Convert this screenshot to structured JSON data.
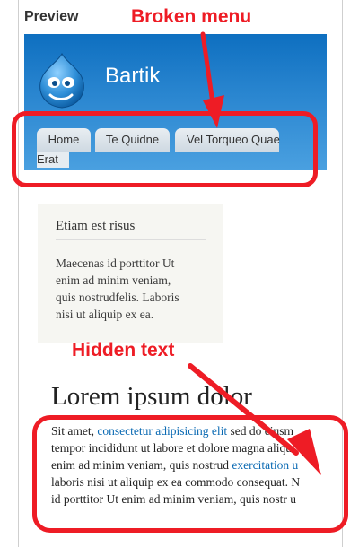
{
  "preview": {
    "label": "Preview"
  },
  "site": {
    "name": "Bartik"
  },
  "menu": {
    "items": [
      "Home",
      "Te Quidne",
      "Vel Torqueo Quae"
    ],
    "overflow": "Erat"
  },
  "block": {
    "title": "Etiam est risus",
    "body": [
      "Maecenas id porttitor Ut",
      "enim ad minim veniam,",
      "quis nostrudfelis. Laboris",
      "nisi ut aliquip ex ea."
    ]
  },
  "content": {
    "title": "Lorem ipsum dolor",
    "line1_a": "Sit amet, ",
    "line1_link": "consectetur adipisicing elit",
    "line1_b": " sed do eiusm",
    "line2": "tempor incididunt ut labore et dolore magna aliqu",
    "line3_a": "enim ad minim veniam, quis nostrud ",
    "line3_link": "exercitation u",
    "line4": "laboris nisi ut aliquip ex ea commodo consequat. N",
    "line5": "id porttitor Ut enim ad minim veniam, quis nostr u"
  },
  "annotations": {
    "broken_menu": "Broken menu",
    "hidden_text": "Hidden text",
    "color": "#ee1c25"
  },
  "colors": {
    "header_top": "#0e6fc0",
    "header_bottom": "#4aa0e0",
    "link": "#0b6ab3",
    "block_bg": "#f6f6f2"
  }
}
